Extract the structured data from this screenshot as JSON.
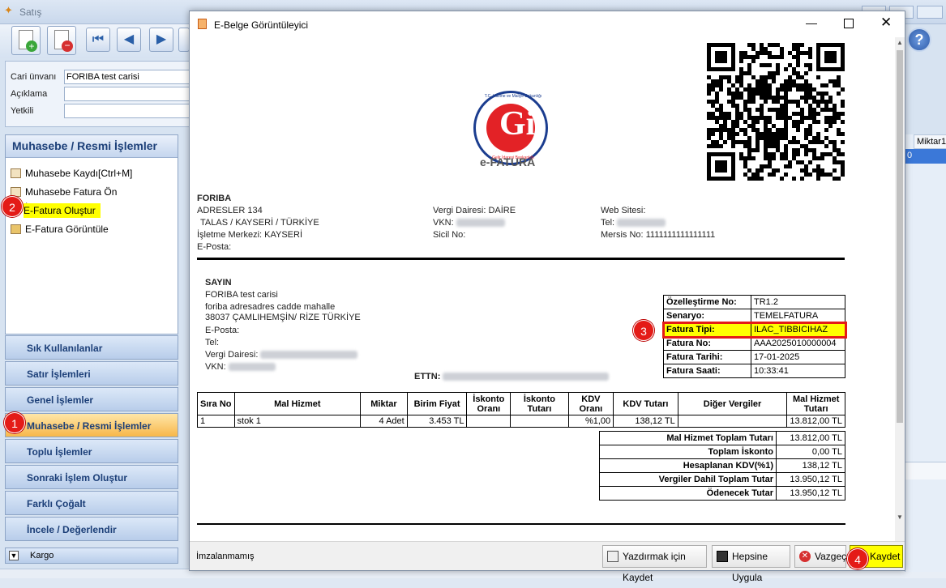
{
  "app": {
    "title": "Satış"
  },
  "form": {
    "cari_label": "Cari ünvanı",
    "cari_value": "FORIBA  test carisi",
    "aciklama_label": "Açıklama",
    "yetkili_label": "Yetkili"
  },
  "left_panel": {
    "title": "Muhasebe / Resmi İşlemler",
    "items": [
      {
        "label": "Muhasebe Kaydı[Ctrl+M]"
      },
      {
        "label": "Muhasebe Fatura Ön İzleme[Ctrl+I]"
      },
      {
        "label": "E-Fatura Oluştur"
      },
      {
        "label": "E-Fatura Görüntüle"
      }
    ]
  },
  "nav_groups": [
    "Sık Kullanılanlar",
    "Satır İşlemleri",
    "Genel İşlemler",
    "Muhasebe / Resmi İşlemler",
    "Toplu İşlemler",
    "Sonraki İşlem Oluştur",
    "Farklı Çoğalt",
    "İncele / Değerlendir"
  ],
  "kargo": "Kargo",
  "right_strip": {
    "col_label": "Miktar1",
    "cell_value": "0"
  },
  "badges": [
    "1",
    "2",
    "3",
    "4"
  ],
  "dialog": {
    "title": "E-Belge Görüntüleyici",
    "status": "İmzalanmamış",
    "buttons": {
      "print_save": "Yazdırmak için Kaydet",
      "apply_all": "Hepsine Uygula",
      "cancel": "Vazgeç",
      "save": "Kaydet"
    }
  },
  "invoice": {
    "logo_top": "T.C. Hazine ve Maliye Bakanlığı",
    "logo_bottom": "Gelir İdaresi Başkanlığı",
    "doc_type": "e-FATURA",
    "seller": {
      "name": "FORIBA",
      "address1": "ADRESLER 134",
      "address2": "TALAS / KAYSERİ / TÜRKİYE",
      "branch": "İşletme Merkezi: KAYSERİ",
      "email": "E-Posta:",
      "tax_office": "Vergi Dairesi: DAİRE",
      "vkn": "VKN:",
      "sicil": "Sicil No:",
      "web": "Web Sitesi:",
      "tel": "Tel:",
      "mersis": "Mersis No: 1111111111111111"
    },
    "buyer": {
      "heading": "SAYIN",
      "name": "FORIBA test carisi",
      "address1": "foriba adresadres cadde mahalle",
      "address2": "38037 ÇAMLIHEMŞİN/ RİZE TÜRKİYE",
      "email": "E-Posta:",
      "tel": "Tel:",
      "tax_office": "Vergi Dairesi:",
      "vkn": "VKN:"
    },
    "ettn_label": "ETTN:",
    "meta": [
      {
        "k": "Özelleştirme No:",
        "v": "TR1.2"
      },
      {
        "k": "Senaryo:",
        "v": "TEMELFATURA"
      },
      {
        "k": "Fatura Tipi:",
        "v": "ILAC_TIBBICIHAZ"
      },
      {
        "k": "Fatura No:",
        "v": "AAA2025010000004"
      },
      {
        "k": "Fatura Tarihi:",
        "v": "17-01-2025"
      },
      {
        "k": "Fatura Saati:",
        "v": "10:33:41"
      }
    ],
    "line_headers": {
      "sira": "Sıra No",
      "mal": "Mal Hizmet",
      "miktar": "Miktar",
      "birim": "Birim Fiyat",
      "isk_oran": "İskonto Oranı",
      "isk_tutar": "İskonto Tutarı",
      "kdv_oran": "KDV Oranı",
      "kdv_tutar": "KDV Tutarı",
      "diger": "Diğer Vergiler",
      "mal_tutar": "Mal Hizmet Tutarı"
    },
    "line": {
      "sira": "1",
      "mal": "stok 1",
      "miktar": "4 Adet",
      "birim": "3.453 TL",
      "isk_oran": "",
      "isk_tutar": "",
      "kdv_oran": "%1,00",
      "kdv_tutar": "138,12 TL",
      "diger": "",
      "mal_tutar": "13.812,00 TL"
    },
    "totals": [
      {
        "k": "Mal Hizmet Toplam Tutarı",
        "v": "13.812,00 TL"
      },
      {
        "k": "Toplam İskonto",
        "v": "0,00 TL"
      },
      {
        "k": "Hesaplanan KDV(%1)",
        "v": "138,12 TL"
      },
      {
        "k": "Vergiler Dahil Toplam Tutar",
        "v": "13.950,12 TL"
      },
      {
        "k": "Ödenecek Tutar",
        "v": "13.950,12 TL"
      }
    ]
  }
}
